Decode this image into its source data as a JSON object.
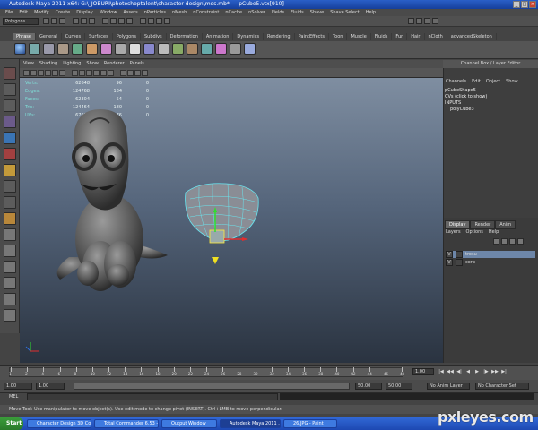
{
  "window": {
    "title": "Autodesk Maya 2011 x64: G:\\_JOBURI\\photoshoptalent\\character design\\mos.mb* --- pCube5.vtx[910]"
  },
  "menubar": [
    "File",
    "Edit",
    "Modify",
    "Create",
    "Display",
    "Window",
    "Assets",
    "nParticles",
    "nMesh",
    "nConstraint",
    "nCache",
    "nSolver",
    "Fields",
    "Fluids",
    "Shave",
    "Shave Select",
    "Help"
  ],
  "statusline": {
    "mode": "Polygons"
  },
  "shelf_tabs": [
    "Phrase",
    "General",
    "Curves",
    "Surfaces",
    "Polygons",
    "Subdivs",
    "Deformation",
    "Animation",
    "Dynamics",
    "Rendering",
    "PaintEffects",
    "Toon",
    "Muscle",
    "Fluids",
    "Fur",
    "Hair",
    "nCloth",
    "advancedSkeleton"
  ],
  "panel_menu": [
    "View",
    "Shading",
    "Lighting",
    "Show",
    "Renderer",
    "Panels"
  ],
  "hud": {
    "rows": [
      {
        "label": "Verts:",
        "v1": "62648",
        "v2": "96",
        "v3": "0"
      },
      {
        "label": "Edges:",
        "v1": "124768",
        "v2": "184",
        "v3": "0"
      },
      {
        "label": "Faces:",
        "v1": "62304",
        "v2": "54",
        "v3": "0"
      },
      {
        "label": "Tris:",
        "v1": "124464",
        "v2": "180",
        "v3": "0"
      },
      {
        "label": "UVs:",
        "v1": "67973",
        "v2": "76",
        "v3": "0"
      }
    ]
  },
  "channel_box": {
    "title": "Channel Box / Layer Editor",
    "menu": [
      "Channels",
      "Edit",
      "Object",
      "Show"
    ],
    "shape": "pCubeShape5",
    "cvs": "CVs (click to show)",
    "inputs_label": "INPUTS",
    "input": "polyCube3"
  },
  "layer_editor": {
    "tabs": [
      "Display",
      "Render",
      "Anim"
    ],
    "menu": [
      "Layers",
      "Options",
      "Help"
    ],
    "layers": [
      {
        "v": "V",
        "name": "trosu",
        "selected": true
      },
      {
        "v": "V",
        "name": "corp",
        "selected": false
      }
    ]
  },
  "timeslider": {
    "ticks": [
      "1",
      "2",
      "4",
      "6",
      "8",
      "10",
      "12",
      "14",
      "16",
      "18",
      "20",
      "22",
      "24",
      "26",
      "28",
      "30",
      "32",
      "34",
      "36",
      "38",
      "40",
      "42",
      "44",
      "46",
      "48"
    ],
    "current_frame": "1.00",
    "play_buttons": [
      "|◀",
      "◀◀",
      "◀|",
      "◀",
      "▶",
      "|▶",
      "▶▶",
      "▶|"
    ]
  },
  "range": {
    "start": "1.00",
    "inner_start": "1.00",
    "inner_end": "50.00",
    "end": "50.00",
    "anim_layer": "No Anim Layer",
    "char_set": "No Character Set"
  },
  "cmd": {
    "label": "MEL"
  },
  "helpline": "Move Tool: Use manipulator to move object(s). Use edit mode to change pivot (INSERT). Ctrl+LMB to move perpendicular.",
  "taskbar": {
    "start": "Start",
    "tasks": [
      {
        "label": "Character Design 3D Co...",
        "active": false
      },
      {
        "label": "Total Commander 6.53 - ...",
        "active": false
      },
      {
        "label": "Output Window",
        "active": false
      },
      {
        "label": "Autodesk Maya 2011 ...",
        "active": true
      },
      {
        "label": "26.JPG - Paint",
        "active": false
      }
    ]
  },
  "watermark": "pxleyes.com"
}
